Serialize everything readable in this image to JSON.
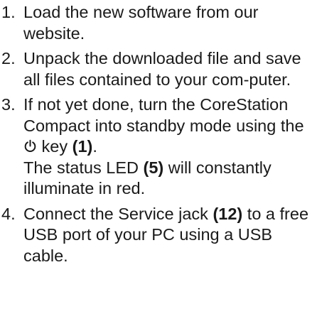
{
  "steps": [
    {
      "number": "1.",
      "text": "Load the new software from our website."
    },
    {
      "number": "2.",
      "text": "Unpack the downloaded file and save all files contained to your com-puter."
    },
    {
      "number": "3.",
      "text_before_icon": "If not yet done, turn the CoreStation Compact into standby mode using the",
      "icon": "power-icon",
      "text_after_icon": "key",
      "ref_1": "(1)",
      "text_end_1": ".",
      "text_line2_start": "The status LED",
      "ref_2": "(5)",
      "text_line2_end": "will constantly illuminate in red."
    },
    {
      "number": "4.",
      "text_before_ref": "Connect the Service jack",
      "ref": "(12)",
      "text_after_ref": "to a free USB port of your PC using a USB cable."
    }
  ]
}
